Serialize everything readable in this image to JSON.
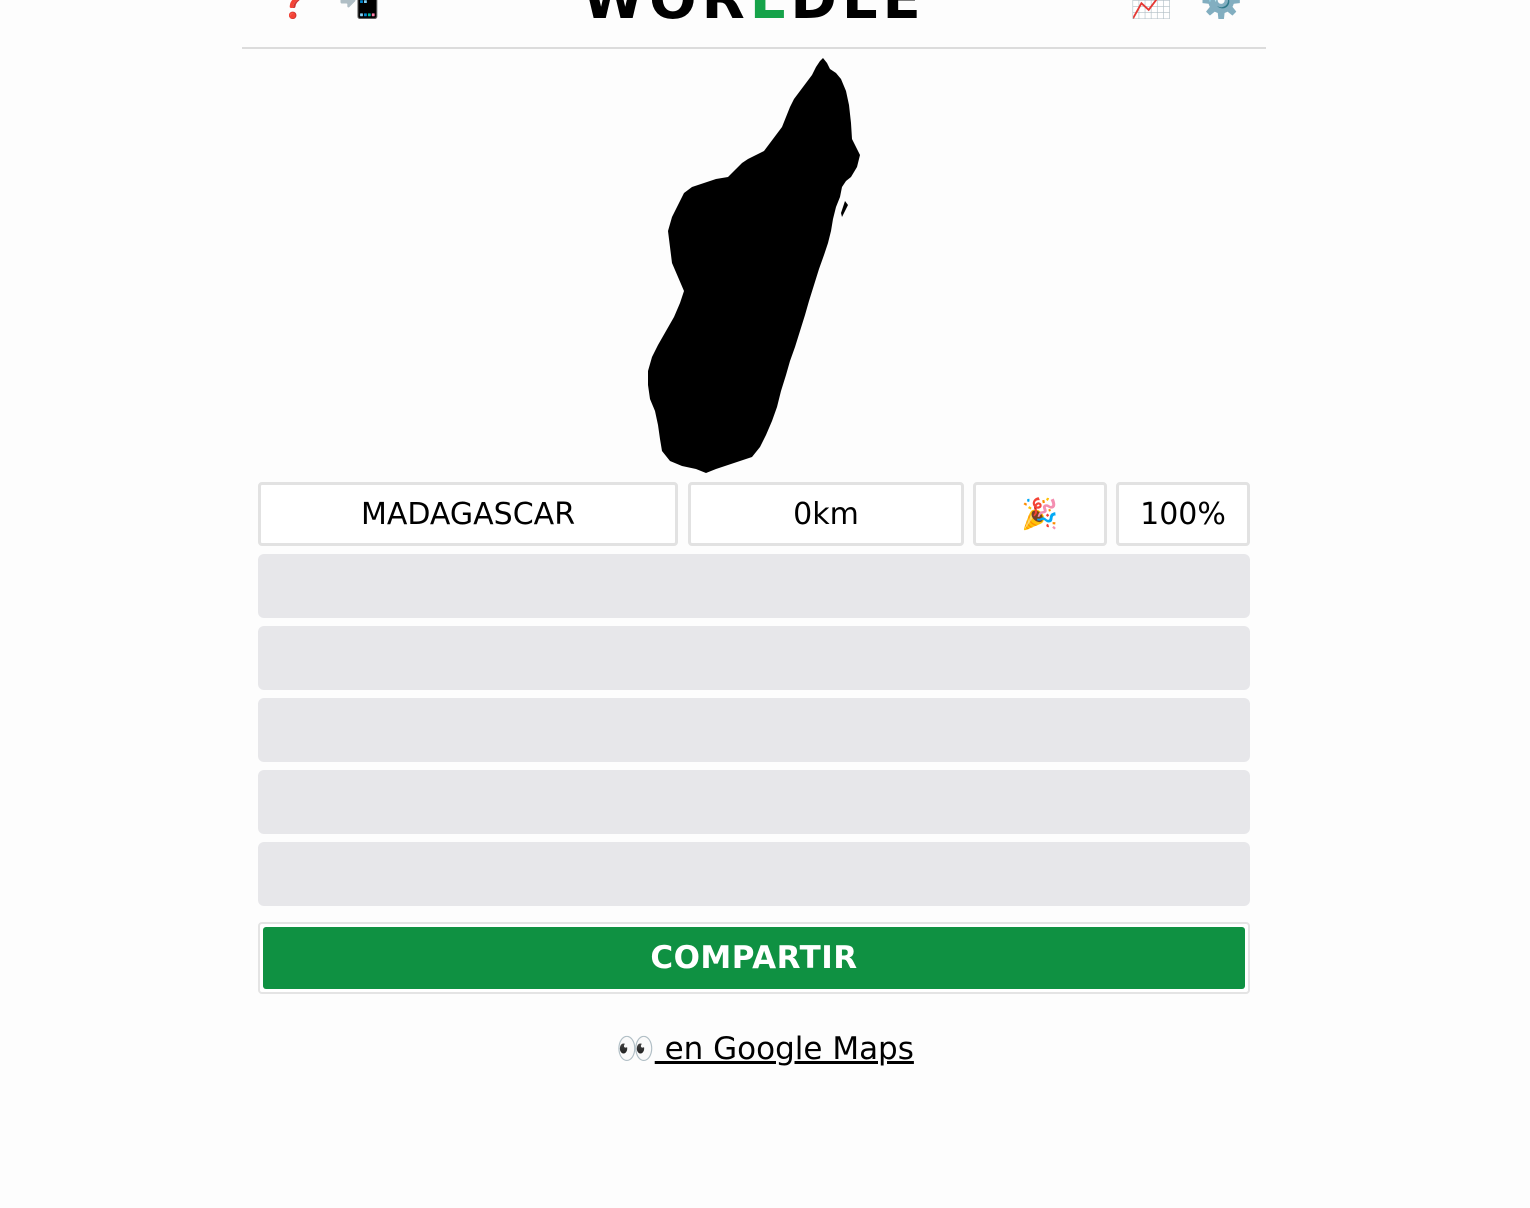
{
  "header": {
    "title_parts": [
      "WOR",
      "L",
      "DLE"
    ],
    "help_icon": "❓",
    "install_icon": "📲",
    "stats_icon": "📈",
    "settings_icon": "⚙️",
    "accent_color": "#16a34a"
  },
  "map": {
    "country_shape": "Madagascar silhouette",
    "fill_color": "#000000"
  },
  "guesses": [
    {
      "country": "MADAGASCAR",
      "distance": "0km",
      "direction_icon": "🎉",
      "proximity": "100%"
    }
  ],
  "empty_rows": 5,
  "share": {
    "label": "COMPARTIR",
    "color": "#0f9142"
  },
  "maps_link": {
    "emoji": "👀",
    "label": " en Google Maps"
  }
}
